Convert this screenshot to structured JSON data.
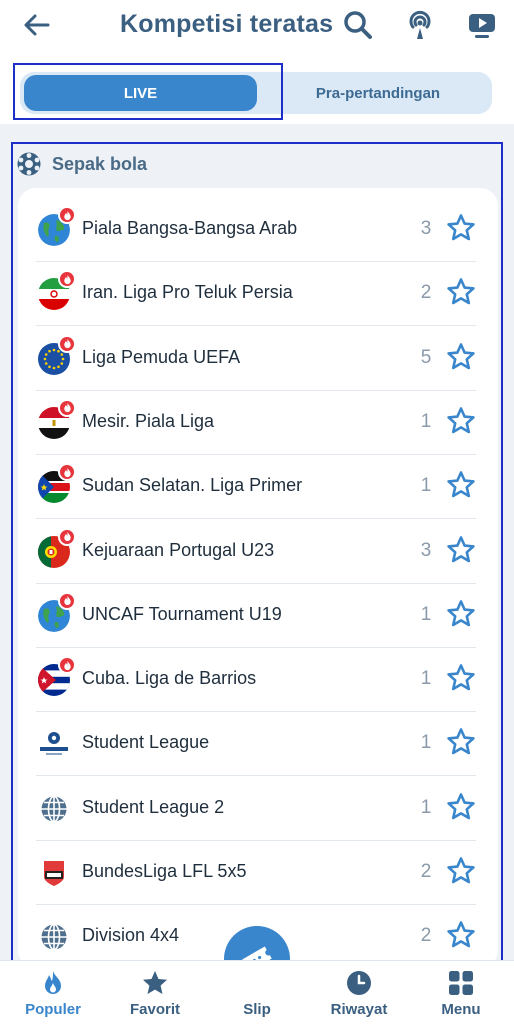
{
  "header": {
    "title": "Kompetisi teratas"
  },
  "tabs": {
    "live": "LIVE",
    "pre": "Pra-pertandingan"
  },
  "section": {
    "title": "Sepak bola"
  },
  "competitions": [
    {
      "name": "Piala Bangsa-Bangsa Arab",
      "count": "3",
      "flag": "globe",
      "live": true
    },
    {
      "name": "Iran. Liga Pro Teluk Persia",
      "count": "2",
      "flag": "iran",
      "live": true
    },
    {
      "name": "Liga Pemuda UEFA",
      "count": "5",
      "flag": "eu",
      "live": true
    },
    {
      "name": "Mesir. Piala Liga",
      "count": "1",
      "flag": "egypt",
      "live": true
    },
    {
      "name": "Sudan Selatan. Liga Primer",
      "count": "1",
      "flag": "south-sudan",
      "live": true
    },
    {
      "name": "Kejuaraan Portugal U23",
      "count": "3",
      "flag": "portugal",
      "live": true
    },
    {
      "name": "UNCAF Tournament U19",
      "count": "1",
      "flag": "globe",
      "live": true
    },
    {
      "name": "Cuba. Liga de Barrios",
      "count": "1",
      "flag": "cuba",
      "live": true
    },
    {
      "name": "Student League",
      "count": "1",
      "flag": "student-logo",
      "live": false
    },
    {
      "name": "Student League 2",
      "count": "1",
      "flag": "world-grid",
      "live": false
    },
    {
      "name": "BundesLiga LFL 5x5",
      "count": "2",
      "flag": "lfl-logo",
      "live": false
    },
    {
      "name": "Division 4x4",
      "count": "2",
      "flag": "world-grid",
      "live": false
    }
  ],
  "nav": {
    "populer": "Populer",
    "favorit": "Favorit",
    "slip": "Slip",
    "riwayat": "Riwayat",
    "menu": "Menu"
  },
  "colors": {
    "accent": "#3a86cc",
    "live_badge": "#e8343c",
    "title": "#3a5f80"
  }
}
